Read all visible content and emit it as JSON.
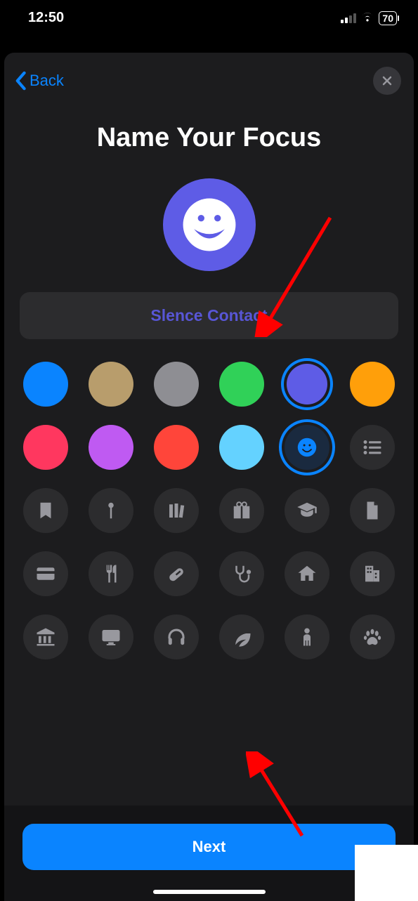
{
  "status": {
    "time": "12:50",
    "battery": "70"
  },
  "nav": {
    "back": "Back"
  },
  "title": "Name Your Focus",
  "focus_name": "Slence Contact",
  "preview_color": "#5e5ce6",
  "colors": [
    {
      "name": "blue",
      "hex": "#0a84ff",
      "selected": false
    },
    {
      "name": "tan",
      "hex": "#b89d6c",
      "selected": false
    },
    {
      "name": "gray",
      "hex": "#8e8e93",
      "selected": false
    },
    {
      "name": "green",
      "hex": "#30d158",
      "selected": false
    },
    {
      "name": "purple",
      "hex": "#5e5ce6",
      "selected": true
    },
    {
      "name": "orange",
      "hex": "#ff9f0a",
      "selected": false
    },
    {
      "name": "red",
      "hex": "#ff375f",
      "selected": false
    },
    {
      "name": "magenta",
      "hex": "#bf5af2",
      "selected": false
    },
    {
      "name": "coral",
      "hex": "#ff453a",
      "selected": false
    },
    {
      "name": "cyan",
      "hex": "#64d2ff",
      "selected": false
    }
  ],
  "selected_icon": "smiley-icon",
  "icons_row2_tail": [
    "smiley-icon",
    "list-icon"
  ],
  "icons": [
    "bookmark-icon",
    "pin-icon",
    "books-icon",
    "gift-icon",
    "grad-cap-icon",
    "document-icon",
    "card-icon",
    "utensils-icon",
    "pill-icon",
    "stethoscope-icon",
    "home-icon",
    "building-icon",
    "bank-icon",
    "monitor-icon",
    "headphones-icon",
    "leaf-icon",
    "person-icon",
    "paw-icon"
  ],
  "footer": {
    "next": "Next"
  }
}
